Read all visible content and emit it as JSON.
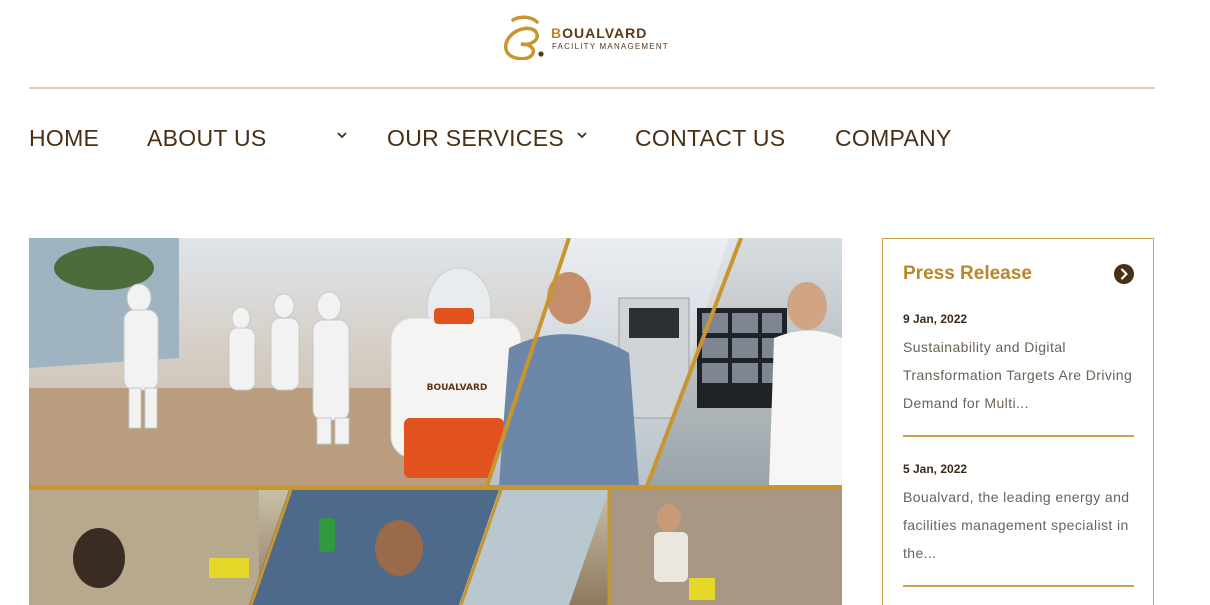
{
  "brand": {
    "name_first": "B",
    "name_rest": "OUALVARD",
    "tagline": "FACILITY MANAGEMENT"
  },
  "nav": {
    "home": "HOME",
    "about": "ABOUT US",
    "services": "OUR SERVICES",
    "contact": "CONTACT US",
    "company": "COMPANY"
  },
  "hero": {
    "sprayer_label": "BOUALVARD"
  },
  "press": {
    "title": "Press Release",
    "items": [
      {
        "date": "9 Jan, 2022",
        "text": "Sustainability and Digital Transformation Targets Are Driving Demand for Multi..."
      },
      {
        "date": "5 Jan, 2022",
        "text": "Boualvard, the leading energy and facilities management specialist in the..."
      }
    ]
  },
  "colors": {
    "brand_gold": "#b8862b",
    "brand_brown": "#4a2f14",
    "divider": "#e2cf9f"
  },
  "icons": {
    "nav_dropdown": "chevron-down-icon",
    "press_more": "arrow-right-circle-icon"
  }
}
